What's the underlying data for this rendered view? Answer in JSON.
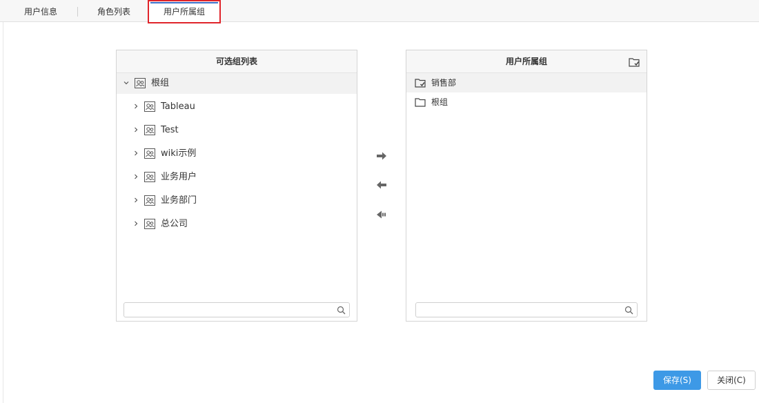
{
  "tabs": [
    {
      "label": "用户信息"
    },
    {
      "label": "角色列表"
    },
    {
      "label": "用户所属组"
    }
  ],
  "left_panel": {
    "title": "可选组列表",
    "tree": [
      {
        "label": "根组"
      },
      {
        "label": "Tableau"
      },
      {
        "label": "Test"
      },
      {
        "label": "wiki示例"
      },
      {
        "label": "业务用户"
      },
      {
        "label": "业务部门"
      },
      {
        "label": "总公司"
      }
    ],
    "search_placeholder": "",
    "search_value": ""
  },
  "right_panel": {
    "title": "用户所属组",
    "items": [
      {
        "label": "销售部"
      },
      {
        "label": "根组"
      }
    ],
    "search_placeholder": "",
    "search_value": ""
  },
  "icons": {
    "add_right": "arrow-right-icon",
    "remove_left": "arrow-left-icon",
    "remove_all": "double-arrow-left-icon",
    "set_default": "folder-check-icon"
  },
  "footer": {
    "save_label": "保存(S)",
    "close_label": "关闭(C)"
  },
  "colors": {
    "active_tab_highlight": "#e0232a",
    "save_button": "#3d99e6"
  }
}
